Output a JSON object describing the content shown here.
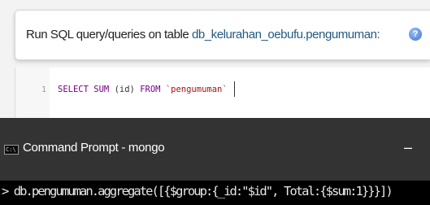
{
  "sql_panel": {
    "title_prefix": "Run SQL query/queries on table",
    "table_name": "db_kelurahan_oebufu.pengumuman:",
    "help_icon": "help-icon",
    "help_glyph": "?",
    "editor": {
      "line_number": "1",
      "tokens": {
        "select": "SELECT",
        "sum": "SUM",
        "paren_open": "(",
        "column": "id",
        "paren_close": ")",
        "from": "FROM",
        "table": "`pengumuman`"
      }
    }
  },
  "cmd_window": {
    "icon": "cmd-icon",
    "icon_glyph": "C:\\",
    "title": "Command Prompt - mongo",
    "minimize_label": "–",
    "prompt_line": "> db.pengumuman.aggregate([{$group:{_id:\"$id\", Total:{$sum:1}}}])"
  }
}
